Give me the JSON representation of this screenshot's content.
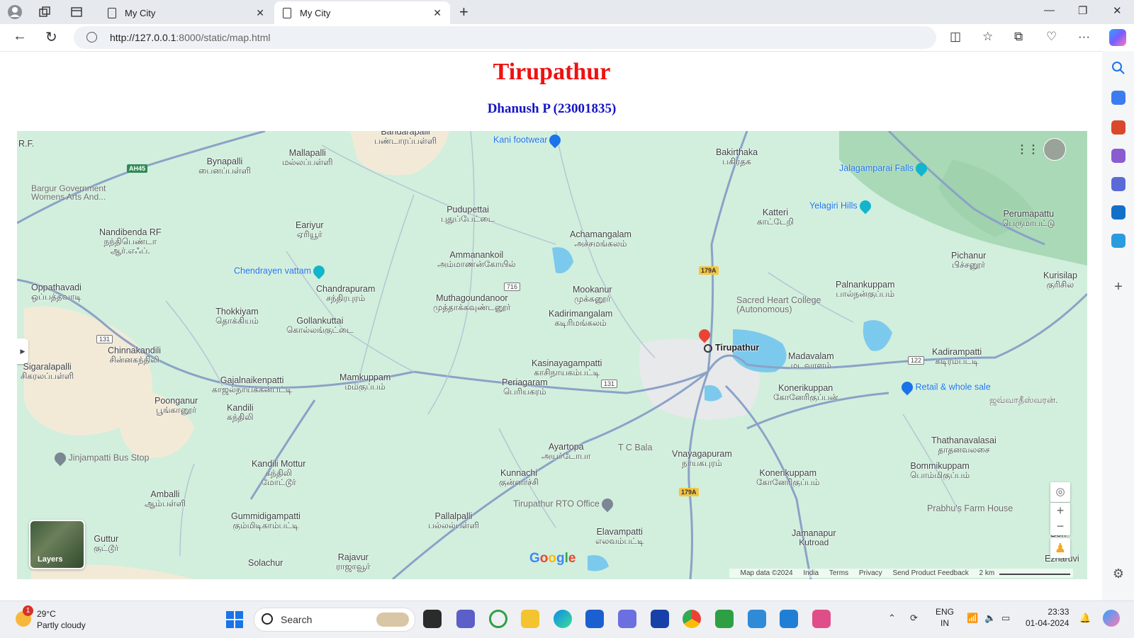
{
  "browser": {
    "tabs": [
      {
        "label": "My City"
      },
      {
        "label": "My City"
      }
    ],
    "url_host": "http://127.0.0.1",
    "url_rest": ":8000/static/map.html"
  },
  "page": {
    "title": "Tirupathur",
    "subtitle": "Dhanush P (23001835)"
  },
  "map": {
    "places": [
      {
        "en": "Bandarapalli",
        "ta": "பண்டாரப்பள்ளி"
      },
      {
        "en": "Bynapalli",
        "ta": "பைனப்பள்ளி"
      },
      {
        "en": "Mallapalli",
        "ta": "மல்லப்பள்ளி"
      },
      {
        "en": "Bakirthaka",
        "ta": "பகிரதக"
      },
      {
        "en": "Pudupettai",
        "ta": "புதுப்பேட்டை"
      },
      {
        "en": "Katteri",
        "ta": "காட்டேறி"
      },
      {
        "en": "Perumapattu",
        "ta": "பெருமாபட்டு"
      },
      {
        "en": "Nandibenda RF",
        "ta": "நந்திபெண்டா",
        "ta2": "ஆர்.எஃப்."
      },
      {
        "en": "Eariyur",
        "ta": "ஏரியூர்"
      },
      {
        "en": "Achamangalam",
        "ta": "அச்சமங்கலம்"
      },
      {
        "en": "Ammanankoil",
        "ta": "அம்மாணன்கோயில்"
      },
      {
        "en": "Pichanur",
        "ta": "பிச்சனூர்"
      },
      {
        "en": "Kurisilap",
        "ta": "குரிசில"
      },
      {
        "en": "Oppathavadi",
        "ta": "ஒப்பத்தவாடி"
      },
      {
        "en": "Chandrapuram",
        "ta": "சந்திரபுரம்"
      },
      {
        "en": "Muthagoundanoor",
        "ta": "முத்தாக்கவுண்டனூர்"
      },
      {
        "en": "Mookanur",
        "ta": "முக்கனூர்"
      },
      {
        "en": "Palnankuppam",
        "ta": "பால்நன்குப்பம்"
      },
      {
        "en": "Thokkiyam",
        "ta": "தொக்கியம்"
      },
      {
        "en": "Gollankuttai",
        "ta": "கொல்லங்குட்டை"
      },
      {
        "en": "Kadirimangalam",
        "ta": "கடிரிமங்கலம்"
      },
      {
        "en": "Chinnakandili",
        "ta": "சின்னகந்திலி"
      },
      {
        "en": "Madavalam",
        "ta": "மடவாளம்"
      },
      {
        "en": "Kadirampatti",
        "ta": "கடிரம்பட்டி"
      },
      {
        "en": "Sigaralapalli",
        "ta": "சிகரலப்பள்ளி"
      },
      {
        "en": "Gajalnaikenpatti",
        "ta": "காஜல்நாய்க்கன்பட்டி"
      },
      {
        "en": "Mamkuppam",
        "ta": "மம்குப்பம்"
      },
      {
        "en": "Kasinayagampatti",
        "ta": "காசிநாயகம்பட்டி"
      },
      {
        "en": "Periagaram",
        "ta": "பெரியகரம்"
      },
      {
        "en": "Konerikuppan",
        "ta": "கோனேரிகுப்பன்"
      },
      {
        "en": "Poonganur",
        "ta": "பூங்கானூர்"
      },
      {
        "en": "Kandili",
        "ta": "கந்திலி"
      },
      {
        "en": "Thathanavalasai",
        "ta": "தாதனவலசை"
      },
      {
        "en": "Ayartopa",
        "ta": "அயர்டோபா"
      },
      {
        "en": "Vnayagapuram",
        "ta": "நாயகபுரம்"
      },
      {
        "en": "Bommikuppam",
        "ta": "பொம்மிகுப்பம்"
      },
      {
        "en": "Kandili Mottur",
        "ta": "கந்திலி",
        "ta2": "மோட்டூர்"
      },
      {
        "en": "Kunnachi",
        "ta": "குன்னாச்சி"
      },
      {
        "en": "Konerikuppam",
        "ta": "கோனேரிகுப்பம்"
      },
      {
        "en": "Amballi",
        "ta": "ஆம்பள்ளி"
      },
      {
        "en": "Gummidigampatti",
        "ta": "கும்மிடிகாம்பட்டி"
      },
      {
        "en": "Pallalpalli",
        "ta": "பல்லல்பள்ளி"
      },
      {
        "en": "Elavampatti",
        "ta": "எலவம்பட்டி"
      },
      {
        "en": "Jamanapur",
        "ta": "Kutroad"
      },
      {
        "en": "Guttur",
        "ta": "குட்டூர்"
      },
      {
        "en": "Rajavur",
        "ta": "ராஜாவூர்"
      },
      {
        "en": "Solachur",
        "ta": ""
      }
    ],
    "pois": {
      "kani": "Kani footwear",
      "jalagamparai": "Jalagamparai Falls",
      "yelagiri": "Yelagiri Hills",
      "chendrayen": "Chendrayen vattam",
      "sacred_heart": "Sacred Heart College",
      "sacred_heart2": "(Autonomous)",
      "retail": "Retail & whole sale",
      "tcbala": "T C Bala",
      "rto": "Tirupathur RTO Office",
      "prabhu": "Prabhu's Farm House",
      "jinjampatti": "Jinjampatti Bus Stop",
      "bargur": "Bargur Government",
      "bargur2": "Womens Arts And...",
      "rf": "R.F.",
      "town": "Tirupathur",
      "bon": "Bon",
      "ezhar": "Ezharuvi",
      "jav": "ஜவ்வாதீஸ்வரன்."
    },
    "roads": [
      "AH45",
      "179A",
      "179A",
      "716",
      "131",
      "131",
      "122"
    ],
    "layers_label": "Layers",
    "footer": [
      "Map data ©2024",
      "India",
      "Terms",
      "Privacy",
      "Send Product Feedback",
      "2 km"
    ],
    "google": "Google"
  },
  "taskbar": {
    "weather_temp": "29°C",
    "weather_desc": "Partly cloudy",
    "weather_badge": "1",
    "search": "Search",
    "lang1": "ENG",
    "lang2": "IN",
    "time": "23:33",
    "date": "01-04-2024"
  },
  "colors": {
    "title": "#ee1111",
    "subtitle": "#1414c8",
    "map_land": "#cfeedb",
    "road": "#8ba2c7",
    "water": "#7cc9ee"
  }
}
